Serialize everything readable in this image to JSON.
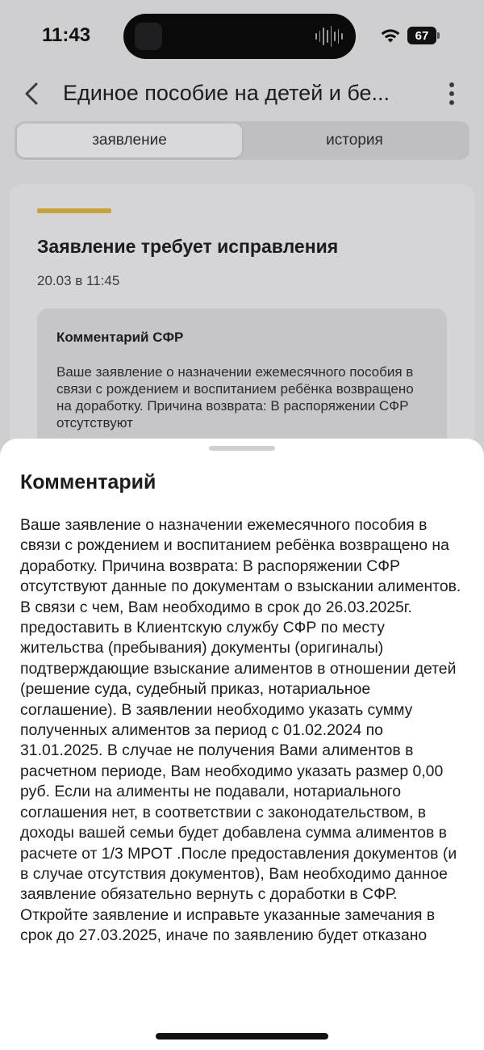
{
  "status_bar": {
    "time": "11:43",
    "battery": "67"
  },
  "nav": {
    "title": "Единое пособие на детей и бе..."
  },
  "tabs": [
    {
      "label": "заявление",
      "active": true
    },
    {
      "label": "история",
      "active": false
    }
  ],
  "card": {
    "status_color": "#c8a13a",
    "title": "Заявление требует исправления",
    "date": "20.03 в 11:45",
    "comment_title": "Комментарий СФР",
    "comment_preview": "Ваше заявление о назначении ежемесячного пособия в связи с рождением и воспитанием ребёнка возвращено на доработку. Причина возврата: В распоряжении СФР отсутствуют"
  },
  "sheet": {
    "title": "Комментарий",
    "text": "Ваше заявление о назначении ежемесячного пособия в связи с рождением и воспитанием ребёнка возвращено на доработку. Причина возврата: В распоряжении СФР отсутствуют данные по документам о взыскании алиментов. В связи с чем, Вам необходимо в срок до 26.03.2025г. предоставить в Клиентскую службу СФР по месту жительства (пребывания) документы (оригиналы) подтверждающие взыскание алиментов в отношении детей (решение суда, судебный приказ, нотариальное соглашение). В заявлении необходимо указать сумму полученных алиментов за период с 01.02.2024 по 31.01.2025. В случае не получения Вами алиментов в расчетном периоде, Вам необходимо указать размер 0,00 руб. Если на алименты не подавали, нотариального соглашения нет, в соответствии с законодательством, в доходы вашей семьи будет добавлена сумма алиментов в расчете от 1/3 МРОТ .После предоставления документов (и в случае отсутствия документов), Вам необходимо данное заявление обязательно вернуть с доработки в СФР. Откройте заявление и исправьте указанные замечания в срок до 27.03.2025, иначе по заявлению будет отказано"
  }
}
